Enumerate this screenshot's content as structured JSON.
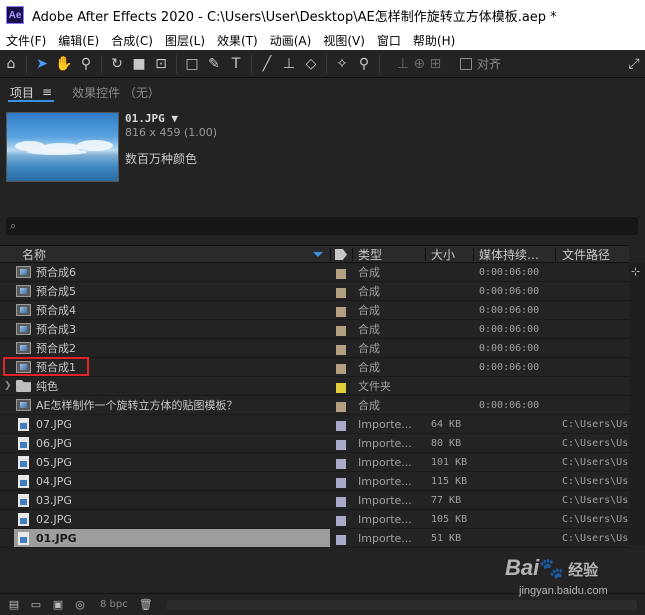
{
  "window": {
    "app_icon": "Ae",
    "title": "Adobe After Effects 2020 - C:\\Users\\User\\Desktop\\AE怎样制作旋转立方体模板.aep *"
  },
  "menu": [
    "文件(F)",
    "编辑(E)",
    "合成(C)",
    "图层(L)",
    "效果(T)",
    "动画(A)",
    "视图(V)",
    "窗口",
    "帮助(H)"
  ],
  "toolbar": {
    "tools": [
      "home-icon",
      "selection-arrow-icon",
      "hand-icon",
      "zoom-icon",
      "rotate-icon",
      "camera-icon",
      "pan-behind-icon",
      "rectangle-icon",
      "pen-icon",
      "type-icon",
      "brush-icon",
      "clone-stamp-icon",
      "eraser-icon",
      "roto-brush-icon",
      "puppet-pin-icon"
    ],
    "snap_label": "对齐"
  },
  "tabs": {
    "project": "项目",
    "effects": "效果控件 （无）"
  },
  "preview": {
    "name": "01.JPG",
    "dims": "816 x 459 (1.00)",
    "color": "数百万种颜色"
  },
  "search": {
    "glyph": "⌕"
  },
  "columns": {
    "name": "名称",
    "type": "类型",
    "size": "大小",
    "duration": "媒体持续…",
    "path": "文件路径"
  },
  "rows": [
    {
      "name": "预合成6",
      "kind": "comp",
      "label_color": "#b3a080",
      "type": "合成",
      "size": "",
      "duration": "0:00:06:00",
      "path": ""
    },
    {
      "name": "预合成5",
      "kind": "comp",
      "label_color": "#b3a080",
      "type": "合成",
      "size": "",
      "duration": "0:00:06:00",
      "path": ""
    },
    {
      "name": "预合成4",
      "kind": "comp",
      "label_color": "#b3a080",
      "type": "合成",
      "size": "",
      "duration": "0:00:06:00",
      "path": ""
    },
    {
      "name": "预合成3",
      "kind": "comp",
      "label_color": "#b3a080",
      "type": "合成",
      "size": "",
      "duration": "0:00:06:00",
      "path": ""
    },
    {
      "name": "预合成2",
      "kind": "comp",
      "label_color": "#b3a080",
      "type": "合成",
      "size": "",
      "duration": "0:00:06:00",
      "path": ""
    },
    {
      "name": "预合成1",
      "kind": "comp",
      "label_color": "#b3a080",
      "type": "合成",
      "size": "",
      "duration": "0:00:06:00",
      "path": ""
    },
    {
      "name": "纯色",
      "kind": "folder",
      "label_color": "#e0cf3c",
      "type": "文件夹",
      "size": "",
      "duration": "",
      "path": ""
    },
    {
      "name": "AE怎样制作一个旋转立方体的贴图模板？",
      "kind": "comp",
      "label_color": "#b3a080",
      "type": "合成",
      "size": "",
      "duration": "0:00:06:00",
      "path": ""
    },
    {
      "name": "07.JPG",
      "kind": "file",
      "label_color": "#a9a9c8",
      "type": "Importe...",
      "size": "64 KB",
      "duration": "",
      "path": "C:\\Users\\Us"
    },
    {
      "name": "06.JPG",
      "kind": "file",
      "label_color": "#a9a9c8",
      "type": "Importe...",
      "size": "80 KB",
      "duration": "",
      "path": "C:\\Users\\Us"
    },
    {
      "name": "05.JPG",
      "kind": "file",
      "label_color": "#a9a9c8",
      "type": "Importe...",
      "size": "101 KB",
      "duration": "",
      "path": "C:\\Users\\Us"
    },
    {
      "name": "04.JPG",
      "kind": "file",
      "label_color": "#a9a9c8",
      "type": "Importe...",
      "size": "115 KB",
      "duration": "",
      "path": "C:\\Users\\Us"
    },
    {
      "name": "03.JPG",
      "kind": "file",
      "label_color": "#a9a9c8",
      "type": "Importe...",
      "size": "77 KB",
      "duration": "",
      "path": "C:\\Users\\Us"
    },
    {
      "name": "02.JPG",
      "kind": "file",
      "label_color": "#a9a9c8",
      "type": "Importe...",
      "size": "105 KB",
      "duration": "",
      "path": "C:\\Users\\Us"
    },
    {
      "name": "01.JPG",
      "kind": "file",
      "label_color": "#a9a9c8",
      "type": "Importe...",
      "size": "51 KB",
      "duration": "",
      "path": "C:\\Users\\Us",
      "selected": true
    }
  ],
  "footer": {
    "bpc": "8 bpc"
  },
  "watermark": {
    "brand": "Bai",
    "cn": "经验",
    "url": "jingyan.baidu.com"
  },
  "colors": {
    "accent": "#3d8fe0",
    "highlight_box": "#e0222a",
    "panel_bg": "#232323"
  }
}
